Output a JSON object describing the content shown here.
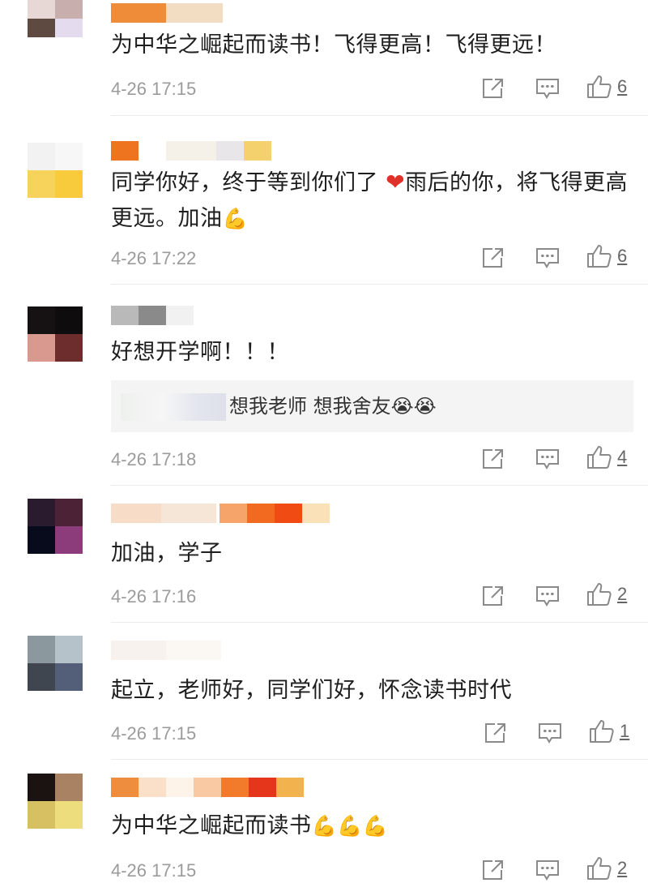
{
  "comments": [
    {
      "text": "为中华之崛起而读书！飞得更高！飞得更远！",
      "time": "4-26 17:15",
      "likes": "6",
      "avatar_colors": [
        "#e7d8d6",
        "#c9aeae",
        "#5e4a41",
        "#e4dcee"
      ],
      "name_colors": [
        "#ef8c3a",
        "#f2dcc2"
      ]
    },
    {
      "text_before_heart": "同学你好，终于等到你们了",
      "heart": "❤",
      "text_after_heart": "雨后的你，将飞得更高更远。加油",
      "emoji": "💪",
      "time": "4-26 17:22",
      "likes": "6",
      "avatar_colors": [
        "#f2f2f2",
        "#f7f7f7",
        "#f8d35c",
        "#f7cb3b"
      ],
      "name_colors": [
        "#ef7420",
        "#ffffff",
        "#f5f0e8",
        "#e8e6e8",
        "#f5d16e"
      ]
    },
    {
      "text": "好想开学啊！！！",
      "reply": "想我老师 想我舍友😭😭",
      "time": "4-26 17:18",
      "likes": "4",
      "avatar_colors": [
        "#161213",
        "#0e0c0c",
        "#d9998e",
        "#6e2d2d"
      ],
      "name_colors": [
        "#b9b9b9",
        "#8a8a8a",
        "#f1f1f1"
      ]
    },
    {
      "text": "加油，学子",
      "time": "4-26 17:16",
      "likes": "2",
      "avatar_colors": [
        "#2b1b2e",
        "#4c2236",
        "#080b1c",
        "#8d3c7b"
      ],
      "name_colors": [
        "#f7ddc7",
        "#f5e6d8",
        "#ffffff",
        "#f7a46b",
        "#f26a20",
        "#f14b14",
        "#fae1b8"
      ]
    },
    {
      "text": "起立，老师好，同学们好，怀念读书时代",
      "time": "4-26 17:15",
      "likes": "1",
      "avatar_colors": [
        "#8b989e",
        "#b6c2c9",
        "#40464f",
        "#535f79"
      ],
      "name_colors": [
        "#f7f2ee",
        "#fbf8f4"
      ]
    },
    {
      "text": "为中华之崛起而读书",
      "emoji": "💪💪💪",
      "time": "4-26 17:15",
      "likes": "2",
      "avatar_colors": [
        "#1b1212",
        "#a98263",
        "#d6c061",
        "#eedd7c"
      ],
      "name_colors": [
        "#ef8d3e",
        "#fbe0c9",
        "#fef3e8",
        "#f9c9a4",
        "#f27a2b",
        "#e5351b",
        "#f2b24d"
      ]
    }
  ],
  "icons": {
    "share": "share-icon",
    "reply": "reply-icon",
    "like": "like-icon"
  }
}
